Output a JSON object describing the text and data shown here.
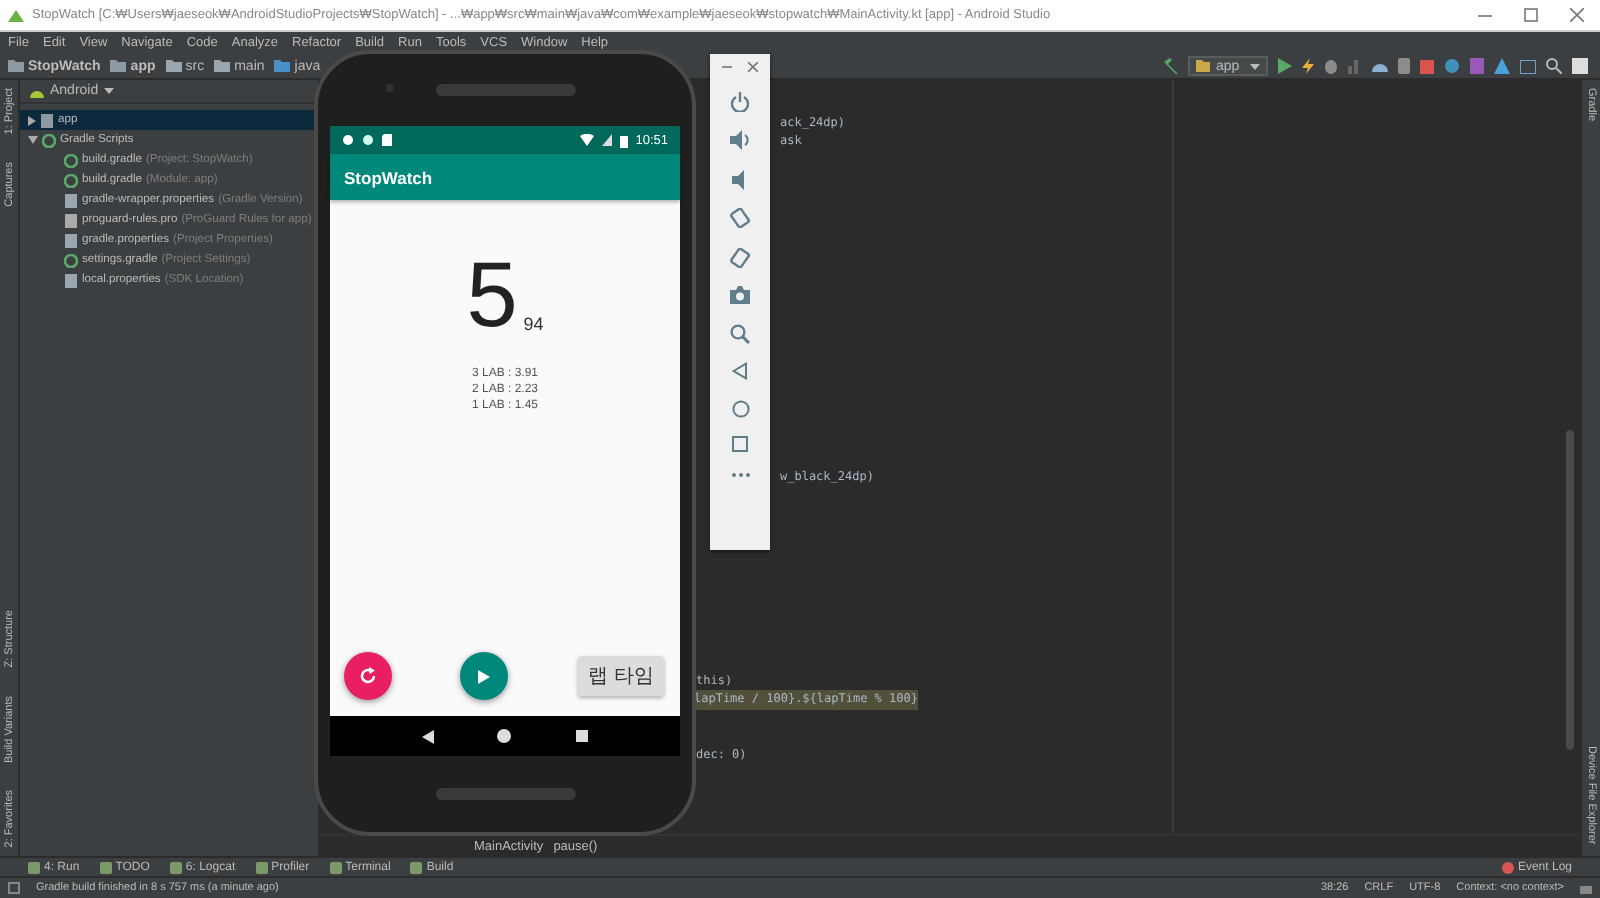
{
  "window": {
    "title": "StopWatch [C:₩Users₩jaeseok₩AndroidStudioProjects₩StopWatch] - ...₩app₩src₩main₩java₩com₩example₩jaeseok₩stopwatch₩MainActivity.kt [app] - Android Studio"
  },
  "menu": [
    "File",
    "Edit",
    "View",
    "Navigate",
    "Code",
    "Analyze",
    "Refactor",
    "Build",
    "Run",
    "Tools",
    "VCS",
    "Window",
    "Help"
  ],
  "breadcrumbs": [
    {
      "label": "StopWatch",
      "kind": "project"
    },
    {
      "label": "app",
      "kind": "module"
    },
    {
      "label": "src",
      "kind": "folder"
    },
    {
      "label": "main",
      "kind": "folder"
    },
    {
      "label": "java",
      "kind": "source"
    }
  ],
  "run_config": {
    "label": "app"
  },
  "left_tool_tabs": {
    "top": [
      "1: Project",
      "Captures"
    ],
    "bottom": [
      "Z: Structure",
      "Build Variants",
      "2: Favorites"
    ]
  },
  "project_panel": {
    "view": "Android",
    "tree": [
      {
        "label": "app",
        "kind": "module",
        "expanded": false,
        "selected": true
      },
      {
        "label": "Gradle Scripts",
        "kind": "gradle",
        "expanded": true,
        "selected": false,
        "children": [
          {
            "label": "build.gradle",
            "note": "(Project: StopWatch)",
            "kind": "gradle",
            "selected": false
          },
          {
            "label": "build.gradle",
            "note": "(Module: app)",
            "kind": "gradle",
            "selected": false
          },
          {
            "label": "gradle-wrapper.properties",
            "note": "(Gradle Version)",
            "kind": "properties",
            "selected": false
          },
          {
            "label": "proguard-rules.pro",
            "note": "(ProGuard Rules for app)",
            "kind": "file",
            "selected": false
          },
          {
            "label": "gradle.properties",
            "note": "(Project Properties)",
            "kind": "properties",
            "selected": false
          },
          {
            "label": "settings.gradle",
            "note": "(Project Settings)",
            "kind": "gradle",
            "selected": false
          },
          {
            "label": "local.properties",
            "note": "(SDK Location)",
            "kind": "properties",
            "selected": false
          }
        ]
      }
    ]
  },
  "editor": {
    "lines": [
      {
        "text": "ack_24dp)",
        "highlighted": false
      },
      {
        "text": "ask",
        "highlighted": false
      },
      {
        "text": "w_black_24dp)",
        "highlighted": false
      },
      {
        "text": "this)",
        "highlighted": false
      },
      {
        "text": "lapTime / 100}.${lapTime % 100}",
        "highlighted": true
      },
      {
        "text": "dec: 0)",
        "highlighted": false
      }
    ],
    "breadcrumb": [
      "MainActivity",
      "pause()"
    ]
  },
  "right_tool_tabs": {
    "top": [
      "Gradle"
    ],
    "bottom": [
      "Device File Explorer"
    ]
  },
  "bottom_tool_tabs": [
    "4: Run",
    "TODO",
    "6: Logcat",
    "Profiler",
    "Terminal",
    "Build"
  ],
  "event_log": "Event Log",
  "status_bar": {
    "message": "Gradle build finished in 8 s 757 ms (a minute ago)",
    "items": [
      "38:26",
      "CRLF",
      "UTF-8",
      "Context: <no context>"
    ]
  },
  "emulator": {
    "status_time": "10:51",
    "app_title": "StopWatch",
    "seconds": "5",
    "hundredths": "94",
    "laps": [
      "3 LAB : 3.91",
      "2 LAB : 2.23",
      "1 LAB : 1.45"
    ],
    "lap_button": "랩 타임"
  }
}
